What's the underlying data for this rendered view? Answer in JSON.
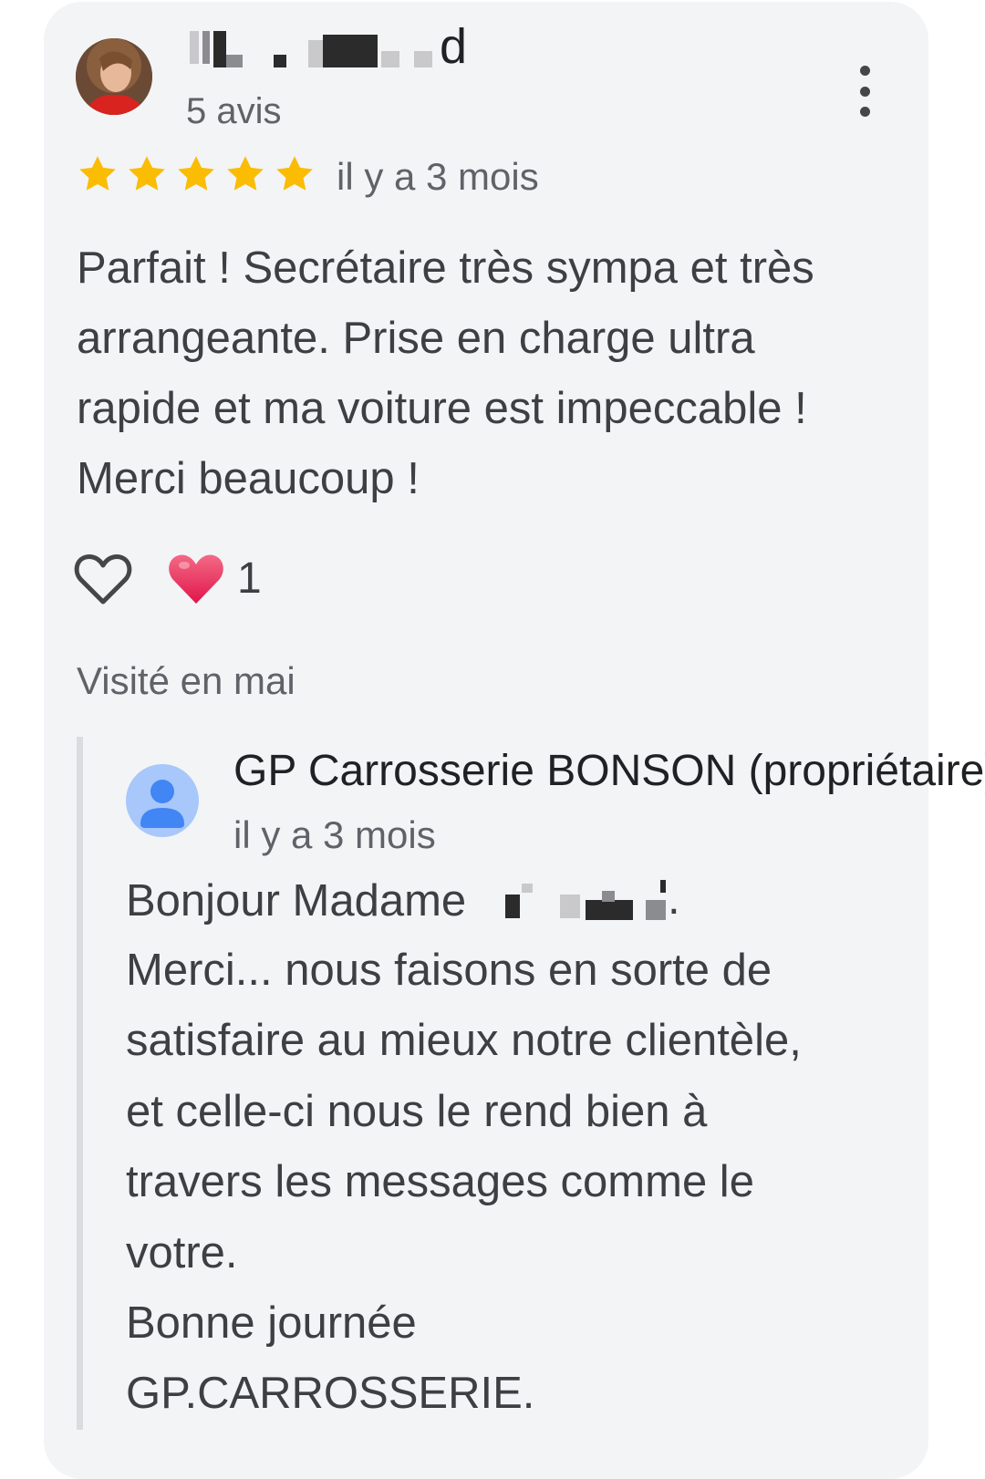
{
  "colors": {
    "card_background": "#f3f4f6",
    "star": "#fbbc04",
    "heart": "#ea4c6e",
    "owner_avatar": "#a8c7fa",
    "owner_avatar_figure": "#4285f4"
  },
  "review": {
    "reviewer_name_visible": "d",
    "review_count": "5 avis",
    "rating_stars": 5,
    "date": "il y a 3 mois",
    "text": "Parfait ! Secrétaire très sympa et très\narrangeante. Prise en charge ultra\nrapide et ma voiture est impeccable !\nMerci beaucoup !",
    "like_icon": "heart-outline-icon",
    "reaction_icon": "red-heart-icon",
    "reaction_count": "1",
    "visited": "Visité en mai",
    "more_icon": "more-vert-icon"
  },
  "owner_reply": {
    "name": "GP Carrosserie BONSON (propriétaire)",
    "date": "il y a 3 mois",
    "greeting": "Bonjour Madame",
    "greeting_end": ".",
    "text": "Merci... nous faisons en sorte de\nsatisfaire au mieux notre clientèle,\net celle-ci nous le rend bien à\ntravers les messages comme le\nvotre.\nBonne journée\nGP.CARROSSERIE.",
    "avatar_icon": "person-icon"
  }
}
